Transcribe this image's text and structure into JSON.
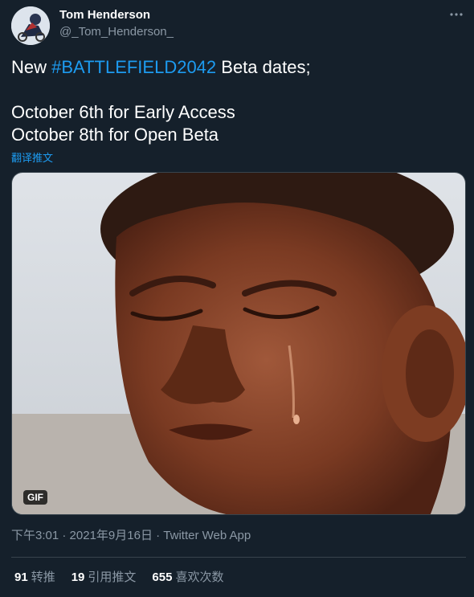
{
  "author": {
    "display_name": "Tom Henderson",
    "handle": "@_Tom_Henderson_",
    "avatar_icon": "avatar-image"
  },
  "menu": {
    "icon": "more-horizontal-icon",
    "label": "···"
  },
  "tweet": {
    "text_prefix": "New ",
    "hashtag": "#BATTLEFIELD2042",
    "text_suffix": " Beta dates;",
    "line2": "October 6th for Early Access",
    "line3": "October 8th for Open Beta",
    "translate_label": "翻译推文"
  },
  "media": {
    "type": "gif",
    "badge": "GIF"
  },
  "meta": {
    "time": "下午3:01",
    "separator": " · ",
    "date": "2021年9月16日",
    "source": "Twitter Web App"
  },
  "stats": {
    "retweets_count": "91",
    "retweets_label": "转推",
    "quotes_count": "19",
    "quotes_label": "引用推文",
    "likes_count": "655",
    "likes_label": "喜欢次数"
  },
  "colors": {
    "background": "#15202b",
    "accent": "#1d9bf0",
    "muted": "#8b98a5",
    "border": "#38444d"
  }
}
